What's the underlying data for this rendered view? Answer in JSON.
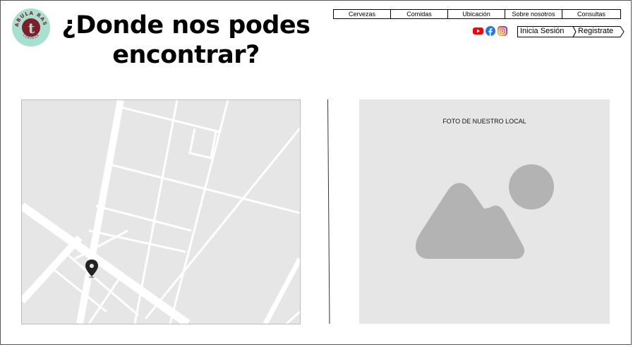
{
  "brand": {
    "logo_top_text": "TABULA RASA",
    "logo_bottom_text": "CERVEZA",
    "colors": {
      "logo_bg": "#a8e0d0",
      "logo_ring": "#7f1d2d",
      "logo_letter": "#7f1d2d"
    }
  },
  "page": {
    "title": "¿Donde nos podes encontrar?"
  },
  "nav": {
    "items": [
      {
        "label": "Cervezas"
      },
      {
        "label": "Comidas"
      },
      {
        "label": "Ubicación"
      },
      {
        "label": "Sobre nosotros"
      },
      {
        "label": "Consultas"
      }
    ]
  },
  "social": {
    "icons": [
      "youtube-icon",
      "facebook-icon",
      "instagram-icon"
    ],
    "colors": {
      "youtube": "#ff0000",
      "facebook": "#1877f2",
      "instagram": "#c13584"
    }
  },
  "auth": {
    "login_label": "Inicia Sesión",
    "register_label": "Registrate"
  },
  "map": {
    "pin_icon": "map-pin-icon",
    "colors": {
      "land": "#e6e6e6",
      "road": "#ffffff",
      "pin": "#222222"
    }
  },
  "photo": {
    "label": "FOTO DE NUESTRO LOCAL",
    "icon": "image-placeholder-icon",
    "colors": {
      "bg": "#e6e6e6",
      "shape": "#b3b3b3"
    }
  }
}
